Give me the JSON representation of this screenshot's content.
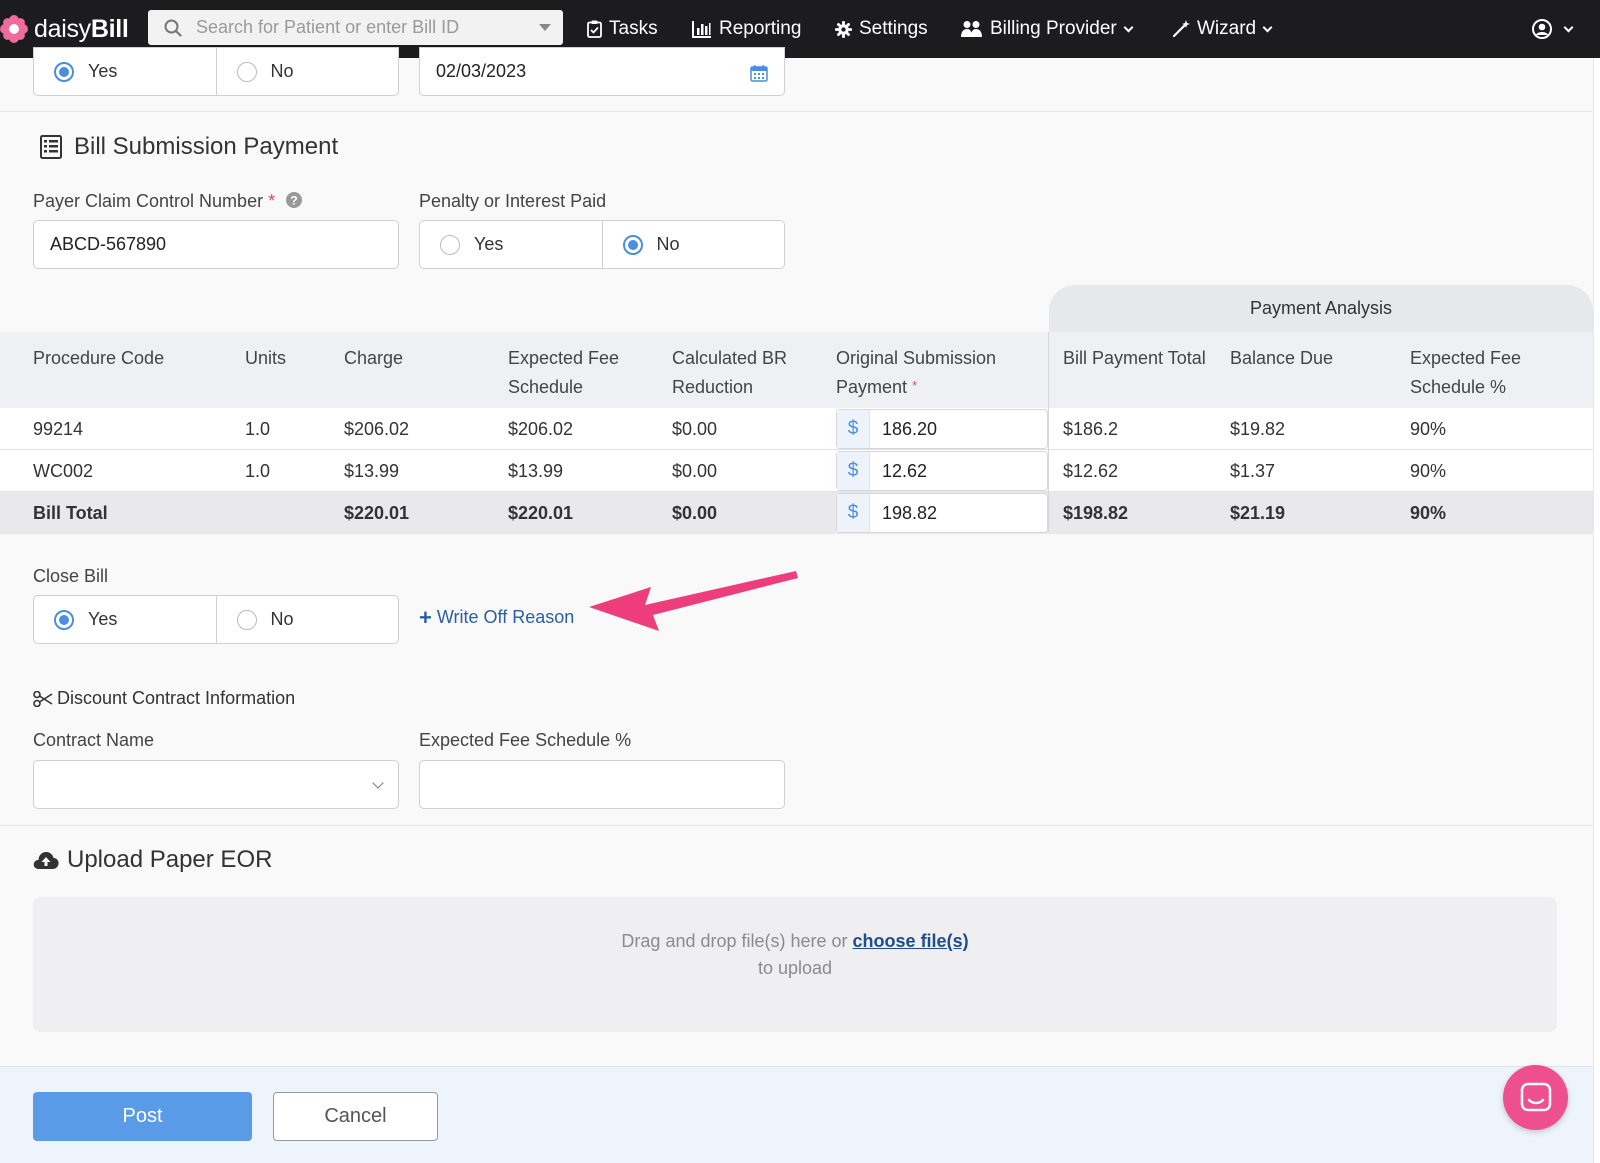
{
  "nav": {
    "logo_light": "daisy",
    "logo_bold": "Bill",
    "search_placeholder": "Search for Patient or enter Bill ID",
    "tasks": "Tasks",
    "reporting": "Reporting",
    "settings": "Settings",
    "billing_provider": "Billing Provider",
    "wizard": "Wizard"
  },
  "top_fields": {
    "radio_yes": "Yes",
    "radio_no": "No",
    "selected": "Yes",
    "date_value": "02/03/2023"
  },
  "bill_submission": {
    "title": "Bill Submission Payment",
    "pccn_label": "Payer Claim Control Number",
    "required_mark": "*",
    "pccn_value": "ABCD-567890",
    "penalty_label": "Penalty or Interest Paid",
    "penalty_yes": "Yes",
    "penalty_no": "No",
    "penalty_selected": "No"
  },
  "table": {
    "payment_analysis": "Payment Analysis",
    "headers": {
      "procedure_code": "Procedure Code",
      "units": "Units",
      "charge": "Charge",
      "expected_fee_1": "Expected Fee",
      "expected_fee_2": "Schedule",
      "calc_br_1": "Calculated BR",
      "calc_br_2": "Reduction",
      "orig_payment_1": "Original Submission",
      "orig_payment_2": "Payment",
      "bill_payment_total": "Bill Payment Total",
      "balance_due": "Balance Due",
      "efs_pct_1": "Expected Fee",
      "efs_pct_2": "Schedule %"
    },
    "currency_symbol": "$",
    "rows": [
      {
        "code": "99214",
        "units": "1.0",
        "charge": "$206.02",
        "expected": "$206.02",
        "br": "$0.00",
        "payment": "186.20",
        "bill_total": "$186.2",
        "balance": "$19.82",
        "pct": "90%"
      },
      {
        "code": "WC002",
        "units": "1.0",
        "charge": "$13.99",
        "expected": "$13.99",
        "br": "$0.00",
        "payment": "12.62",
        "bill_total": "$12.62",
        "balance": "$1.37",
        "pct": "90%"
      }
    ],
    "total": {
      "label": "Bill Total",
      "charge": "$220.01",
      "expected": "$220.01",
      "br": "$0.00",
      "payment": "198.82",
      "bill_total": "$198.82",
      "balance": "$21.19",
      "pct": "90%"
    }
  },
  "close_bill": {
    "label": "Close Bill",
    "yes": "Yes",
    "no": "No",
    "selected": "Yes",
    "write_off_plus": "+",
    "write_off": "Write Off Reason"
  },
  "discount": {
    "title": "Discount Contract Information",
    "contract_name_label": "Contract Name",
    "contract_name_value": "",
    "efs_pct_label": "Expected Fee Schedule %",
    "efs_pct_value": ""
  },
  "upload": {
    "title": "Upload Paper EOR",
    "drop_text": "Drag and drop file(s) here or",
    "choose_link": "choose file(s)",
    "drop_text_2": "to upload"
  },
  "footer": {
    "post": "Post",
    "cancel": "Cancel"
  },
  "colors": {
    "accent_blue": "#5a9be8",
    "pink_arrow": "#ee3d7b",
    "chat_pink": "#ee4f8f",
    "link_blue": "#2b5fa0"
  }
}
